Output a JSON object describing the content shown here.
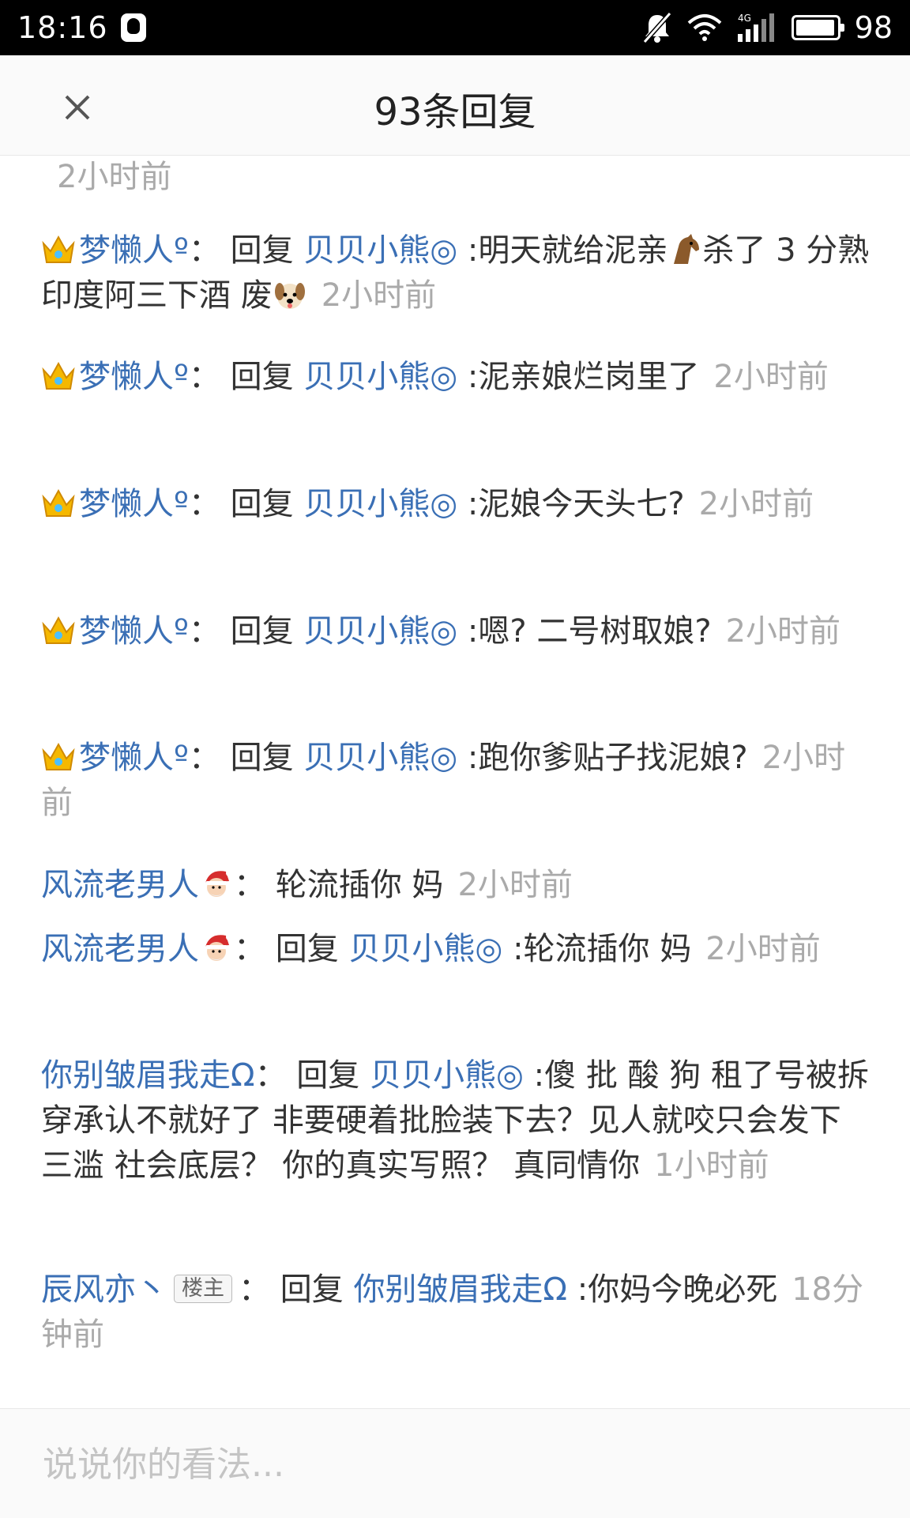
{
  "status_bar": {
    "time": "18:16",
    "battery": "98",
    "network": "4G"
  },
  "header": {
    "title": "93条回复"
  },
  "orphan_time": "2小时前",
  "comments": [
    {
      "user": "梦懒人º",
      "sep": "：",
      "reply_word": "回复",
      "mention": "贝贝小熊◎",
      "text_a": ":明天就给泥亲",
      "text_b": "杀了 3 分熟 印度阿三下酒 废",
      "time": "2小时前"
    },
    {
      "user": "梦懒人º",
      "sep": "：",
      "reply_word": "回复",
      "mention": "贝贝小熊◎",
      "text": ":泥亲娘烂岗里了",
      "time": "2小时前"
    },
    {
      "user": "梦懒人º",
      "sep": "：",
      "reply_word": "回复",
      "mention": "贝贝小熊◎",
      "text": ":泥娘今天头七?",
      "time": "2小时前"
    },
    {
      "user": "梦懒人º",
      "sep": "：",
      "reply_word": "回复",
      "mention": "贝贝小熊◎",
      "text": ":嗯? 二号树取娘?",
      "time": "2小时前"
    },
    {
      "user": "梦懒人º",
      "sep": "：",
      "reply_word": "回复",
      "mention": "贝贝小熊◎",
      "text": ":跑你爹贴子找泥娘?",
      "time": "2小时前"
    },
    {
      "user": "风流老男人",
      "sep": "：",
      "text": "轮流插你 妈",
      "time": "2小时前"
    },
    {
      "user": "风流老男人",
      "sep": "：",
      "reply_word": "回复",
      "mention": "贝贝小熊◎",
      "text": ":轮流插你 妈",
      "time": "2小时前"
    },
    {
      "user": "你别皱眉我走Ω",
      "sep": "：",
      "reply_word": "回复",
      "mention": "贝贝小熊◎",
      "text": ":傻 批 酸 狗 租了号被拆穿承认不就好了 非要硬着批脸装下去？见人就咬只会发下三滥 社会底层？ 你的真实写照？ 真同情你",
      "time": "1小时前"
    },
    {
      "user": "辰风亦丶",
      "badge": "楼主",
      "sep": "：",
      "reply_word": "回复",
      "mention": "你别皱眉我走Ω",
      "text": ":你妈今晚必死",
      "time": "18分钟前"
    }
  ],
  "footer": {
    "placeholder": "说说你的看法..."
  }
}
